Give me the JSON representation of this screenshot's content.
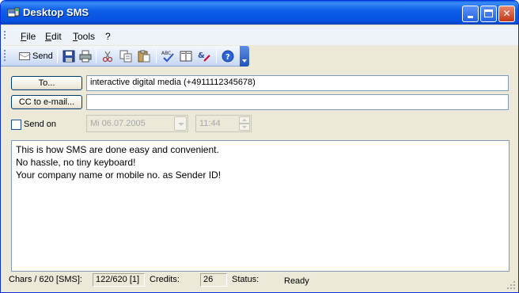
{
  "window": {
    "title": "Desktop SMS",
    "controls": {
      "minimize": "_",
      "maximize": "□",
      "close": "✕"
    }
  },
  "menubar": {
    "items": [
      {
        "accel": "F",
        "rest": "ile"
      },
      {
        "accel": "E",
        "rest": "dit"
      },
      {
        "accel": "T",
        "rest": "ools"
      },
      {
        "accel": "",
        "rest": "?"
      }
    ]
  },
  "toolbar": {
    "send_label": "Send",
    "icons": [
      "save-icon",
      "print-icon",
      "cut-icon",
      "copy-icon",
      "paste-icon",
      "spellcheck-icon",
      "address-book-icon",
      "clear-icon",
      "help-icon"
    ]
  },
  "form": {
    "to_button": "To...",
    "to_value": "interactive digital media (+4911112345678)",
    "cc_button": "CC to e-mail...",
    "cc_value": "",
    "send_on_label": "Send on",
    "send_on_checked": false,
    "date_value": "Mi 06.07.2005",
    "time_value": "11:44"
  },
  "message": {
    "lines": [
      "This is how SMS are done easy and convenient.",
      "No hassle, no tiny keyboard!",
      "Your company name or mobile no. as Sender ID!"
    ]
  },
  "status": {
    "chars_label": "Chars / 620 [SMS]:",
    "chars_value": "122/620 [1]",
    "credits_label": "Credits:",
    "credits_value": "26",
    "status_label": "Status:",
    "status_value": "Ready"
  },
  "colors": {
    "title_bar": "#0351e0",
    "window_bg": "#ece9d8",
    "toolbar_bg": "#c6d7f3",
    "close_button": "#c2381a"
  }
}
